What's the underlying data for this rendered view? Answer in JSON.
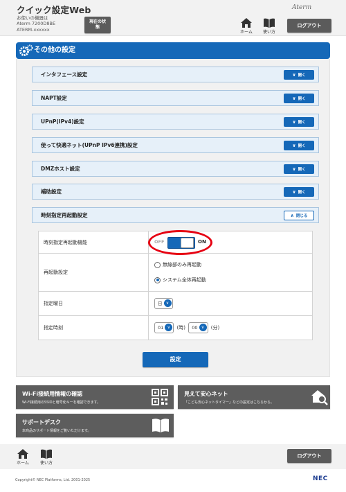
{
  "header": {
    "title": "クイック設定Web",
    "device_lines": [
      "お使いの機器は",
      "Aterm 7200D8BE",
      "ATERM-xxxxxx"
    ],
    "status_button": "現在の状態",
    "home_label": "ホーム",
    "howto_label": "使い方",
    "logo": "Aterm",
    "logout": "ログアウト"
  },
  "section_title": "その他の設定",
  "accordions": [
    {
      "label": "インタフェース設定",
      "button": "開く"
    },
    {
      "label": "NAPT設定",
      "button": "開く"
    },
    {
      "label": "UPnP(IPv4)設定",
      "button": "開く"
    },
    {
      "label": "使って快適ネット(UPnP IPv6連携)設定",
      "button": "開く"
    },
    {
      "label": "DMZホスト設定",
      "button": "開く"
    },
    {
      "label": "補助設定",
      "button": "開く"
    },
    {
      "label": "時刻指定再起動設定",
      "button": "閉じる"
    }
  ],
  "form": {
    "reboot_function_label": "時刻指定再起動機能",
    "toggle_off": "OFF",
    "toggle_on": "ON",
    "toggle_state": "ON",
    "reboot_setting_label": "再起動設定",
    "radio_wireless": "無線部のみ再起動",
    "radio_system": "システム全体再起動",
    "radio_selected": "システム全体再起動",
    "weekday_label": "指定曜日",
    "weekday_value": "日",
    "time_label": "指定時刻",
    "hour_value": "01",
    "hour_unit": "(時)",
    "minute_value": "00",
    "minute_unit": "(分)"
  },
  "set_button": "設定",
  "cards": {
    "wifi_title": "Wi-Fi接続用情報の確認",
    "wifi_sub": "Wi-Fi接続用のSSIDと暗号化キーを確認できます。",
    "safe_title": "見えて安心ネット",
    "safe_sub": "「こども安心ネットタイマー」などの設定はこちらから。",
    "support_title": "サポートデスク",
    "support_sub": "本商品のサポート情報をご覧いただけます。"
  },
  "footer": {
    "home_label": "ホーム",
    "howto_label": "使い方",
    "logout": "ログアウト",
    "copyright": "Copyright© NEC Platforms, Ltd. 2001-2025",
    "brand": "NEC"
  },
  "colors": {
    "primary": "#1568b8",
    "accordion_bg": "#e6f0f9",
    "dark_button": "#5b5b5b",
    "highlight": "#e60012"
  }
}
